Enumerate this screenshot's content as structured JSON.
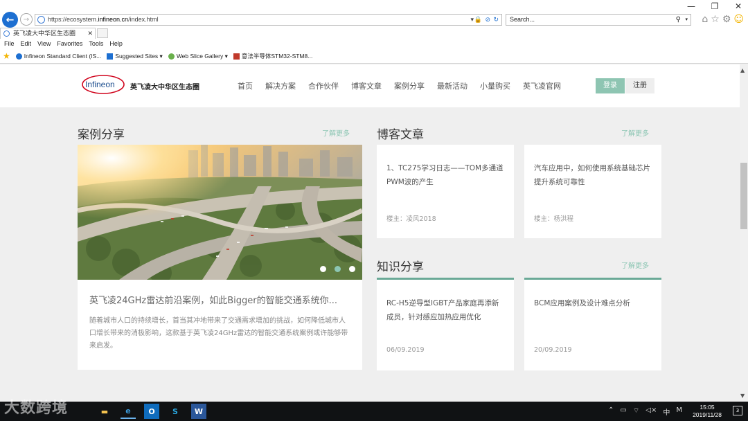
{
  "browser": {
    "url": "https://ecosystem.infineon.cn/index.html",
    "url_prefix": "https://ecosystem.",
    "url_domain": "infineon.cn",
    "url_path": "/index.html",
    "search_placeholder": "Search...",
    "tab_title": "英飞凌大中华区生态圈",
    "menu": [
      "File",
      "Edit",
      "View",
      "Favorites",
      "Tools",
      "Help"
    ],
    "favorites": [
      "Infineon Standard Client (IS...",
      "Suggested Sites ▾",
      "Web Slice Gallery ▾",
      "意法半导体STM32-STM8..."
    ]
  },
  "site": {
    "logo_text": "Infineon",
    "brand_text": "英飞凌大中华区生态圈",
    "nav": [
      "首页",
      "解决方案",
      "合作伙伴",
      "博客文章",
      "案例分享",
      "最新活动",
      "小量购买",
      "英飞凌官网"
    ],
    "login": "登录",
    "register": "注册"
  },
  "cases": {
    "title": "案例分享",
    "more": "了解更多",
    "slide_count": 3,
    "active_slide": 1,
    "headline": "英飞凌24GHz雷达前沿案例，如此Bigger的智能交通系统你...",
    "desc": "随着城市人口的持续增长，首当其冲地带来了交通需求增加的挑战，如何降低城市人口增长带来的消极影响，这款基于英飞凌24GHz雷达的智能交通系统案例或许能够带来启发。"
  },
  "blog": {
    "title": "博客文章",
    "more": "了解更多",
    "items": [
      {
        "title": "1、TC275学习日志——TOM多通道PWM波的产生",
        "author": "楼主：凌风2018"
      },
      {
        "title": "汽车应用中，如何使用系统基础芯片提升系统可靠性",
        "author": "楼主：杨洪程"
      }
    ]
  },
  "knowledge": {
    "title": "知识分享",
    "more": "了解更多",
    "items": [
      {
        "title": "RC-H5逆导型IGBT产品家庭再添新成员，针对感应加热应用优化",
        "date": "06/09.2019"
      },
      {
        "title": "BCM应用案例及设计难点分析",
        "date": "20/09.2019"
      }
    ]
  },
  "taskbar": {
    "time": "15:05",
    "date": "2019/11/28",
    "ime": "中",
    "notifications": "3",
    "watermark": "大数跨境"
  },
  "colors": {
    "accent": "#8ec5b2",
    "accent_dark": "#6aa996",
    "browser_blue": "#1d6fd1"
  }
}
